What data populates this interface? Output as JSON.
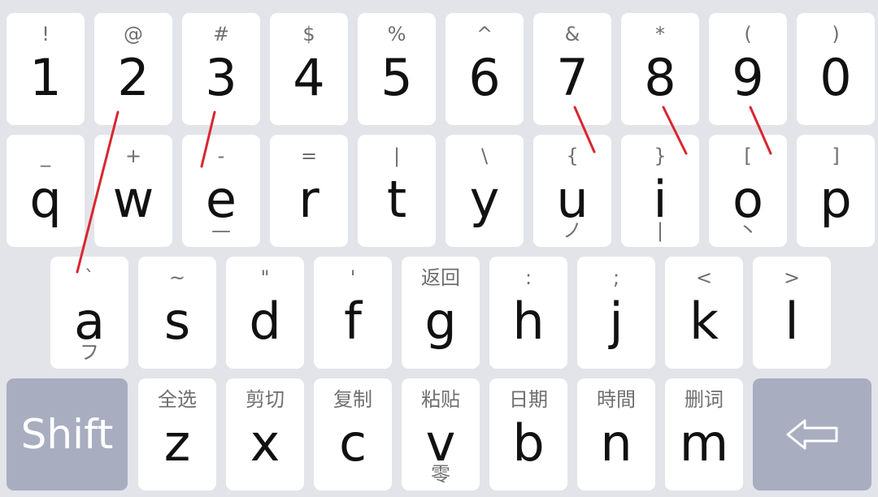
{
  "keyboard": {
    "rows": [
      [
        {
          "id": "1",
          "main": "1",
          "sec": "!",
          "ter": ""
        },
        {
          "id": "2",
          "main": "2",
          "sec": "@",
          "ter": ""
        },
        {
          "id": "3",
          "main": "3",
          "sec": "#",
          "ter": ""
        },
        {
          "id": "4",
          "main": "4",
          "sec": "$",
          "ter": ""
        },
        {
          "id": "5",
          "main": "5",
          "sec": "%",
          "ter": ""
        },
        {
          "id": "6",
          "main": "6",
          "sec": "^",
          "ter": ""
        },
        {
          "id": "7",
          "main": "7",
          "sec": "&",
          "ter": ""
        },
        {
          "id": "8",
          "main": "8",
          "sec": "*",
          "ter": ""
        },
        {
          "id": "9",
          "main": "9",
          "sec": "(",
          "ter": ""
        },
        {
          "id": "0",
          "main": "0",
          "sec": ")",
          "ter": ""
        }
      ],
      [
        {
          "id": "q",
          "main": "q",
          "sec": "_",
          "ter": ""
        },
        {
          "id": "w",
          "main": "w",
          "sec": "+",
          "ter": ""
        },
        {
          "id": "e",
          "main": "e",
          "sec": "-",
          "ter": "—"
        },
        {
          "id": "r",
          "main": "r",
          "sec": "=",
          "ter": ""
        },
        {
          "id": "t",
          "main": "t",
          "sec": "|",
          "ter": ""
        },
        {
          "id": "y",
          "main": "y",
          "sec": "\\",
          "ter": ""
        },
        {
          "id": "u",
          "main": "u",
          "sec": "{",
          "ter": "ノ"
        },
        {
          "id": "i",
          "main": "i",
          "sec": "}",
          "ter": "|"
        },
        {
          "id": "o",
          "main": "o",
          "sec": "[",
          "ter": "丶"
        },
        {
          "id": "p",
          "main": "p",
          "sec": "]",
          "ter": ""
        }
      ],
      [
        {
          "id": "a",
          "main": "a",
          "sec": "`",
          "ter": "フ"
        },
        {
          "id": "s",
          "main": "s",
          "sec": "~",
          "ter": ""
        },
        {
          "id": "d",
          "main": "d",
          "sec": "\"",
          "ter": ""
        },
        {
          "id": "f",
          "main": "f",
          "sec": "'",
          "ter": ""
        },
        {
          "id": "g",
          "main": "g",
          "sec": "返回",
          "ter": ""
        },
        {
          "id": "h",
          "main": "h",
          "sec": ":",
          "ter": ""
        },
        {
          "id": "j",
          "main": "j",
          "sec": ";",
          "ter": ""
        },
        {
          "id": "k",
          "main": "k",
          "sec": "<",
          "ter": ""
        },
        {
          "id": "l",
          "main": "l",
          "sec": ">",
          "ter": ""
        }
      ],
      [
        {
          "id": "z",
          "main": "z",
          "sec": "全选",
          "ter": ""
        },
        {
          "id": "x",
          "main": "x",
          "sec": "剪切",
          "ter": ""
        },
        {
          "id": "c",
          "main": "c",
          "sec": "复制",
          "ter": ""
        },
        {
          "id": "v",
          "main": "v",
          "sec": "粘贴",
          "ter": "零"
        },
        {
          "id": "b",
          "main": "b",
          "sec": "日期",
          "ter": ""
        },
        {
          "id": "n",
          "main": "n",
          "sec": "時間",
          "ter": ""
        },
        {
          "id": "m",
          "main": "m",
          "sec": "删词",
          "ter": ""
        }
      ]
    ],
    "shift_label": "Shift",
    "backspace_icon": "backspace-arrow-icon",
    "colors": {
      "background": "#e3e4e9",
      "key": "#ffffff",
      "function_key": "#a8aec0",
      "stroke": "#d92630"
    }
  }
}
